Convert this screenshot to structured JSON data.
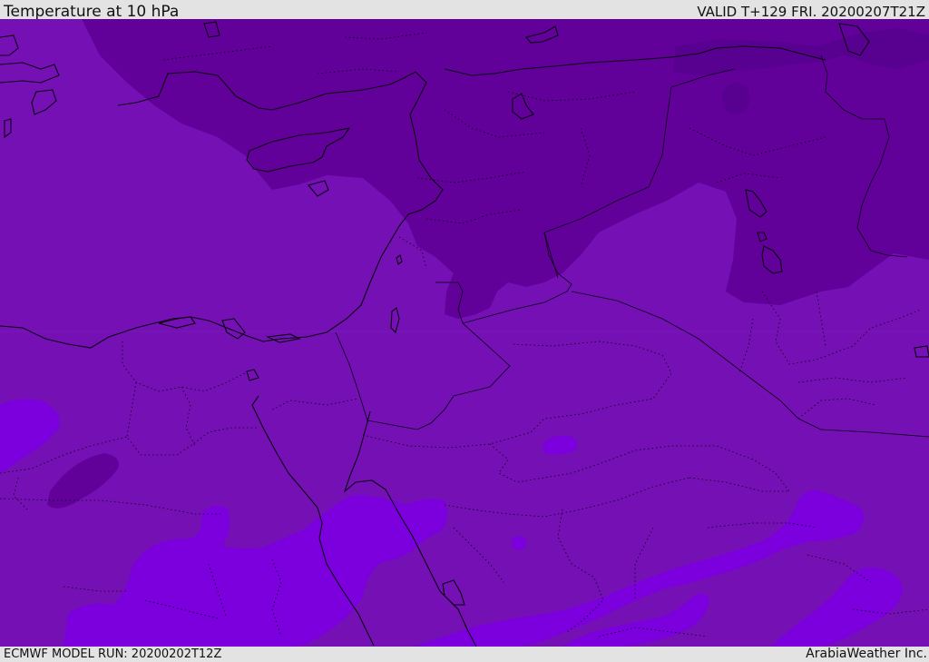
{
  "header": {
    "title": "Temperature at 10 hPa",
    "valid_time": "VALID T+129 FRI. 20200207T21Z"
  },
  "footer": {
    "model_run": "ECMWF MODEL RUN: 20200202T12Z",
    "credit": "ArabiaWeather Inc."
  },
  "map": {
    "field": "temperature",
    "pressure_level": "10 hPa",
    "colors": {
      "cold": "#62009a",
      "mid": "#7410b4",
      "warm": "#7b00dd",
      "coast": "#0a0010"
    }
  }
}
